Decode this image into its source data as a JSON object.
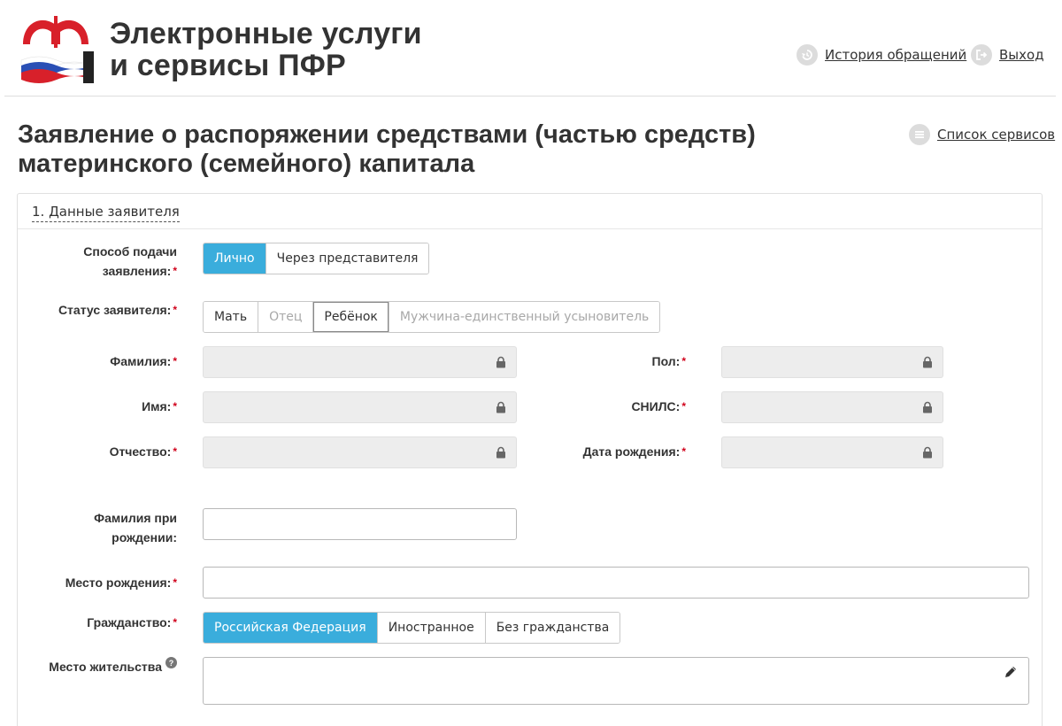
{
  "header": {
    "brand_line1": "Электронные услуги",
    "brand_line2": "и сервисы ПФР",
    "history_label": "История обращений",
    "logout_label": "Выход",
    "logo_text": "ПФР"
  },
  "page": {
    "title_line1": "Заявление о распоряжении средствами (частью средств)",
    "title_line2": "материнского (семейного) капитала",
    "services_label": "Список сервисов"
  },
  "section": {
    "title": "1. Данные заявителя"
  },
  "form": {
    "submit_method": {
      "label_line1": "Способ подачи",
      "label_line2": "заявления:",
      "options": [
        "Лично",
        "Через представителя"
      ],
      "selected": "Лично"
    },
    "applicant_status": {
      "label": "Статус заявителя:",
      "options": [
        "Мать",
        "Отец",
        "Ребёнок",
        "Мужчина-единственный усыновитель"
      ]
    },
    "surname": {
      "label": "Фамилия:"
    },
    "name": {
      "label": "Имя:"
    },
    "patronymic": {
      "label": "Отчество:"
    },
    "gender": {
      "label": "Пол:"
    },
    "snils": {
      "label": "СНИЛС:"
    },
    "birth_date": {
      "label": "Дата рождения:"
    },
    "birth_surname": {
      "label_line1": "Фамилия при",
      "label_line2": "рождении:",
      "value": ""
    },
    "birth_place": {
      "label": "Место рождения:",
      "value": ""
    },
    "citizenship": {
      "label": "Гражданство:",
      "options": [
        "Российская Федерация",
        "Иностранное",
        "Без гражданства"
      ],
      "selected": "Российская Федерация"
    },
    "residence": {
      "label": "Место жительства",
      "value": ""
    },
    "required_mark": "*",
    "help_mark": "?"
  },
  "colors": {
    "accent": "#3aaddc",
    "required": "#d0021b",
    "locked_bg": "#ededed"
  }
}
